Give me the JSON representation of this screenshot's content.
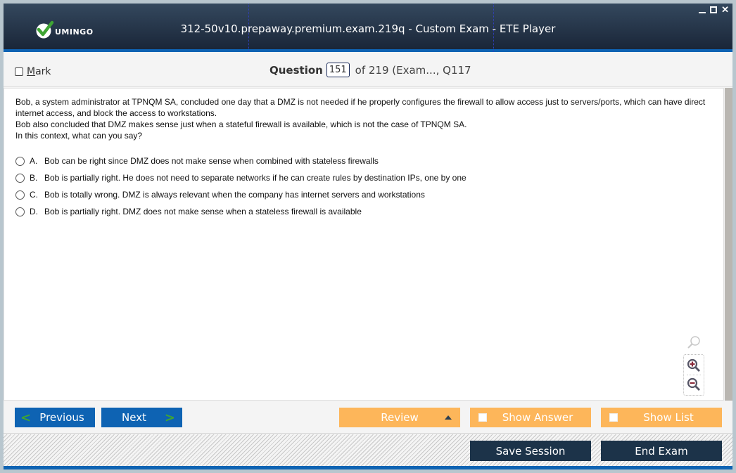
{
  "window": {
    "title": "312-50v10.prepaway.premium.exam.219q - Custom Exam - ETE Player",
    "logo_text": "UMINGO",
    "controls": [
      "minimize",
      "maximize",
      "close"
    ],
    "close_glyph": "✕"
  },
  "header": {
    "mark_label_underlined": "M",
    "mark_label_rest": "ark",
    "mark_checked": false,
    "question_word": "Question",
    "question_number": "151",
    "question_of": "of 219 (Exam..., Q117"
  },
  "question": {
    "text_lines": [
      "Bob, a system administrator at TPNQM SA, concluded one day that a DMZ is not needed if he properly configures the firewall to allow access just to servers/ports, which can have direct internet access, and block the access to workstations.",
      "Bob also concluded that DMZ makes sense just when a stateful firewall is available, which is not the case of TPNQM SA.",
      "In this context, what can you say?"
    ],
    "options": [
      {
        "letter": "A.",
        "text": "Bob can be right since DMZ does not make sense when combined with stateless firewalls",
        "selected": false
      },
      {
        "letter": "B.",
        "text": "Bob is partially right. He does not need to separate networks if he can create rules by destination IPs, one by one",
        "selected": false
      },
      {
        "letter": "C.",
        "text": "Bob is totally wrong. DMZ is always relevant when the company has internet servers and workstations",
        "selected": false
      },
      {
        "letter": "D.",
        "text": "Bob is partially right. DMZ does not make sense when a stateless firewall is available",
        "selected": false
      }
    ]
  },
  "zoom_tools": [
    "search-icon",
    "zoom-in-icon",
    "zoom-out-icon"
  ],
  "nav": {
    "previous": "Previous",
    "next": "Next",
    "review": "Review",
    "show_answer": "Show Answer",
    "show_list": "Show List",
    "chev_left": "<",
    "chev_right": ">"
  },
  "footer": {
    "save_session": "Save Session",
    "end_exam": "End Exam"
  },
  "colors": {
    "titlebar": "#1a2638",
    "accent_blue": "#0e63b3",
    "orange": "#fdb65a",
    "dark_button": "#1c3349",
    "logo_green": "#3fa534"
  }
}
